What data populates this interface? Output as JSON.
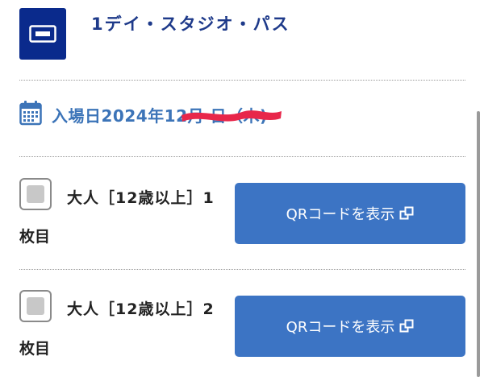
{
  "ticket": {
    "title": "1デイ・スタジオ・パス"
  },
  "visit": {
    "date_label": "入場日2024年12月 日（木)"
  },
  "guests": [
    {
      "label": "大人［12歳以上］1",
      "sub": "枚目",
      "button_label": "QRコードを表示"
    },
    {
      "label": "大人［12歳以上］2",
      "sub": "枚目",
      "button_label": "QRコードを表示"
    }
  ],
  "colors": {
    "brand_navy": "#0a2a8c",
    "title_blue": "#1e3a8a",
    "date_blue": "#3c74b8",
    "button_blue": "#3c74c4",
    "redaction_red": "#e8264a"
  },
  "icons": {
    "ticket": "ticket-icon",
    "calendar": "calendar-icon",
    "external": "external-link-icon"
  }
}
